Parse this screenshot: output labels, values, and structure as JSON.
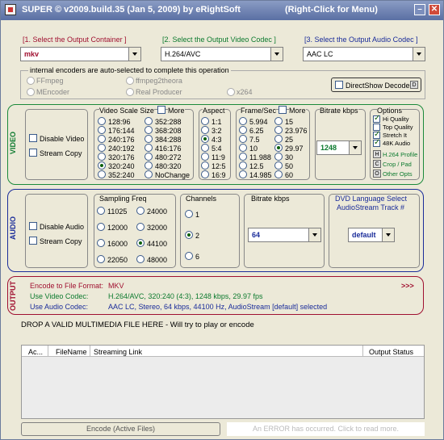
{
  "window": {
    "title": "SUPER © v2009.build.35 (Jan 5, 2009) by eRightSoft",
    "right_click_hint": "(Right-Click for Menu)",
    "minimize_symbol": "–",
    "close_symbol": "✕"
  },
  "header": {
    "container_label": "[1.    Select the Output Container ]",
    "video_codec_label": "[2.  Select the Output Video Codec ]",
    "audio_codec_label": "[3.  Select the Output Audio Codec ]",
    "container_value": "mkv",
    "video_codec_value": "H.264/AVC",
    "audio_codec_value": "AAC LC"
  },
  "encoders": {
    "note": "internal encoders are auto-selected to complete this operation",
    "options": [
      "FFmpeg",
      "ffmpeg2theora",
      "MEncoder",
      "Real Producer",
      "x264"
    ],
    "directshow_label": "DirectShow Decode",
    "directshow_icon_letter": "D"
  },
  "video": {
    "section_label": "VIDEO",
    "disable_label": "Disable Video",
    "stream_copy_label": "Stream Copy",
    "scale_title": "Video Scale Size",
    "more_label": "More",
    "scale_col1": [
      "128:96",
      "176:144",
      "240:176",
      "240:192",
      "320:176",
      "320:240",
      "352:240"
    ],
    "scale_col2": [
      "352:288",
      "368:208",
      "384:288",
      "416:176",
      "480:272",
      "480:320",
      "NoChange"
    ],
    "scale_selected": "320:240",
    "aspect_title": "Aspect",
    "aspects": [
      "1:1",
      "3:2",
      "4:3",
      "5:4",
      "11:9",
      "12:5",
      "16:9"
    ],
    "aspect_selected": "4:3",
    "fps_title": "Frame/Sec",
    "fps_more": "More",
    "fps_col1": [
      "5.994",
      "6.25",
      "7.5",
      "10",
      "11.988",
      "12.5",
      "14.985"
    ],
    "fps_col2": [
      "15",
      "23.976",
      "25",
      "29.97",
      "30",
      "50",
      "60"
    ],
    "fps_selected": "29.97",
    "bitrate_title": "Bitrate  kbps",
    "bitrate_value": "1248",
    "options_title": "Options",
    "options": [
      {
        "label": "Hi Quality",
        "checked": true
      },
      {
        "label": "Top Quality",
        "checked": false
      },
      {
        "label": "Stretch It",
        "checked": true
      },
      {
        "label": "48K Audio",
        "checked": true
      }
    ],
    "icon_options": [
      {
        "letter": "H",
        "label": "H.264 Profile"
      },
      {
        "letter": "C",
        "label": "Crop / Pad"
      },
      {
        "letter": "O",
        "label": "Other Opts"
      }
    ]
  },
  "audio": {
    "section_label": "AUDIO",
    "disable_label": "Disable Audio",
    "stream_copy_label": "Stream Copy",
    "freq_title": "Sampling Freq",
    "freq_col1": [
      "11025",
      "12000",
      "16000",
      "22050"
    ],
    "freq_col2": [
      "24000",
      "32000",
      "44100",
      "48000"
    ],
    "freq_selected": "44100",
    "channels_title": "Channels",
    "channels": [
      "1",
      "2",
      "6"
    ],
    "channels_selected": "2",
    "bitrate_title": "Bitrate  kbps",
    "bitrate_value": "64",
    "dvd_title": "DVD Language Select",
    "dvd_subtitle": "AudioStream  Track #",
    "dvd_value": "default"
  },
  "output": {
    "section_label": "OUTPUT",
    "file_format_label": "Encode to File Format:",
    "file_format_value": "MKV",
    "video_codec_label": "Use Video Codec:",
    "video_codec_value": "H.264/AVC,   320:240 (4:3),   1248 kbps,   29.97 fps",
    "audio_codec_label": "Use Audio Codec:",
    "audio_codec_value": "AAC LC,  Stereo,  64 kbps,  44100 Hz,  AudioStream [default] selected",
    "more_arrows": ">>>"
  },
  "drop_message": "DROP A VALID MULTIMEDIA FILE HERE - Will try to play or encode",
  "list": {
    "columns": [
      "Ac...",
      "FileName",
      "Streaming Link",
      "Output Status"
    ]
  },
  "footer": {
    "encode_button": "Encode (Active Files)",
    "error_text": "An ERROR has occurred. Click to read more."
  },
  "colors": {
    "title_bar": "#5a6fa3",
    "video": "#1b8a3a",
    "audio": "#1a2c9a",
    "output": "#a01030"
  }
}
